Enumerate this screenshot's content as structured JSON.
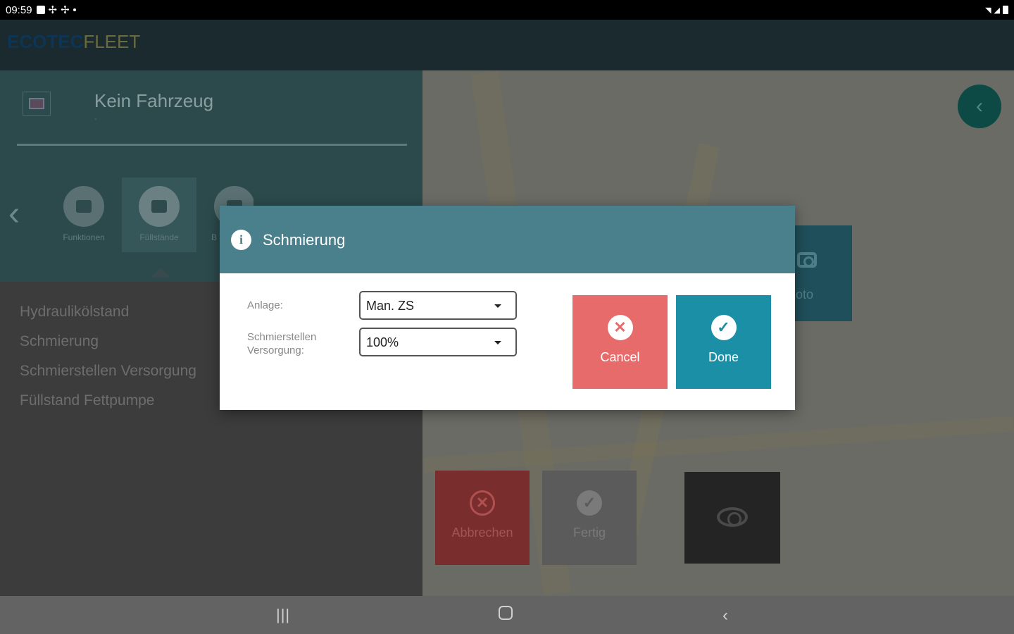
{
  "status_bar": {
    "time": "09:59"
  },
  "app": {
    "brand_part1": "ECOTEC",
    "brand_part2": "FLEET"
  },
  "vehicle": {
    "title": "Kein Fahrzeug",
    "subtitle": "-"
  },
  "categories": [
    {
      "label": "Funktionen"
    },
    {
      "label": "Füllstände"
    },
    {
      "label": "B"
    }
  ],
  "menu_items": [
    "Hydraulikölstand",
    "Schmierung",
    "Schmierstellen Versorgung",
    "Füllstand Fettpumpe"
  ],
  "background_buttons": {
    "foto_label": "oto",
    "abort_label": "Abbrechen",
    "done_label": "Fertig"
  },
  "dialog": {
    "title": "Schmierung",
    "info_glyph": "i",
    "fields": [
      {
        "label": "Anlage:",
        "value": "Man. ZS"
      },
      {
        "label": "Schmierstellen Versorgung:",
        "value": "100%"
      }
    ],
    "cancel_label": "Cancel",
    "done_label": "Done"
  },
  "icons": {
    "cancel": "close-circle-icon",
    "done": "check-circle-icon",
    "back": "chevron-left-icon",
    "camera": "camera-icon",
    "eye": "eye-icon"
  }
}
